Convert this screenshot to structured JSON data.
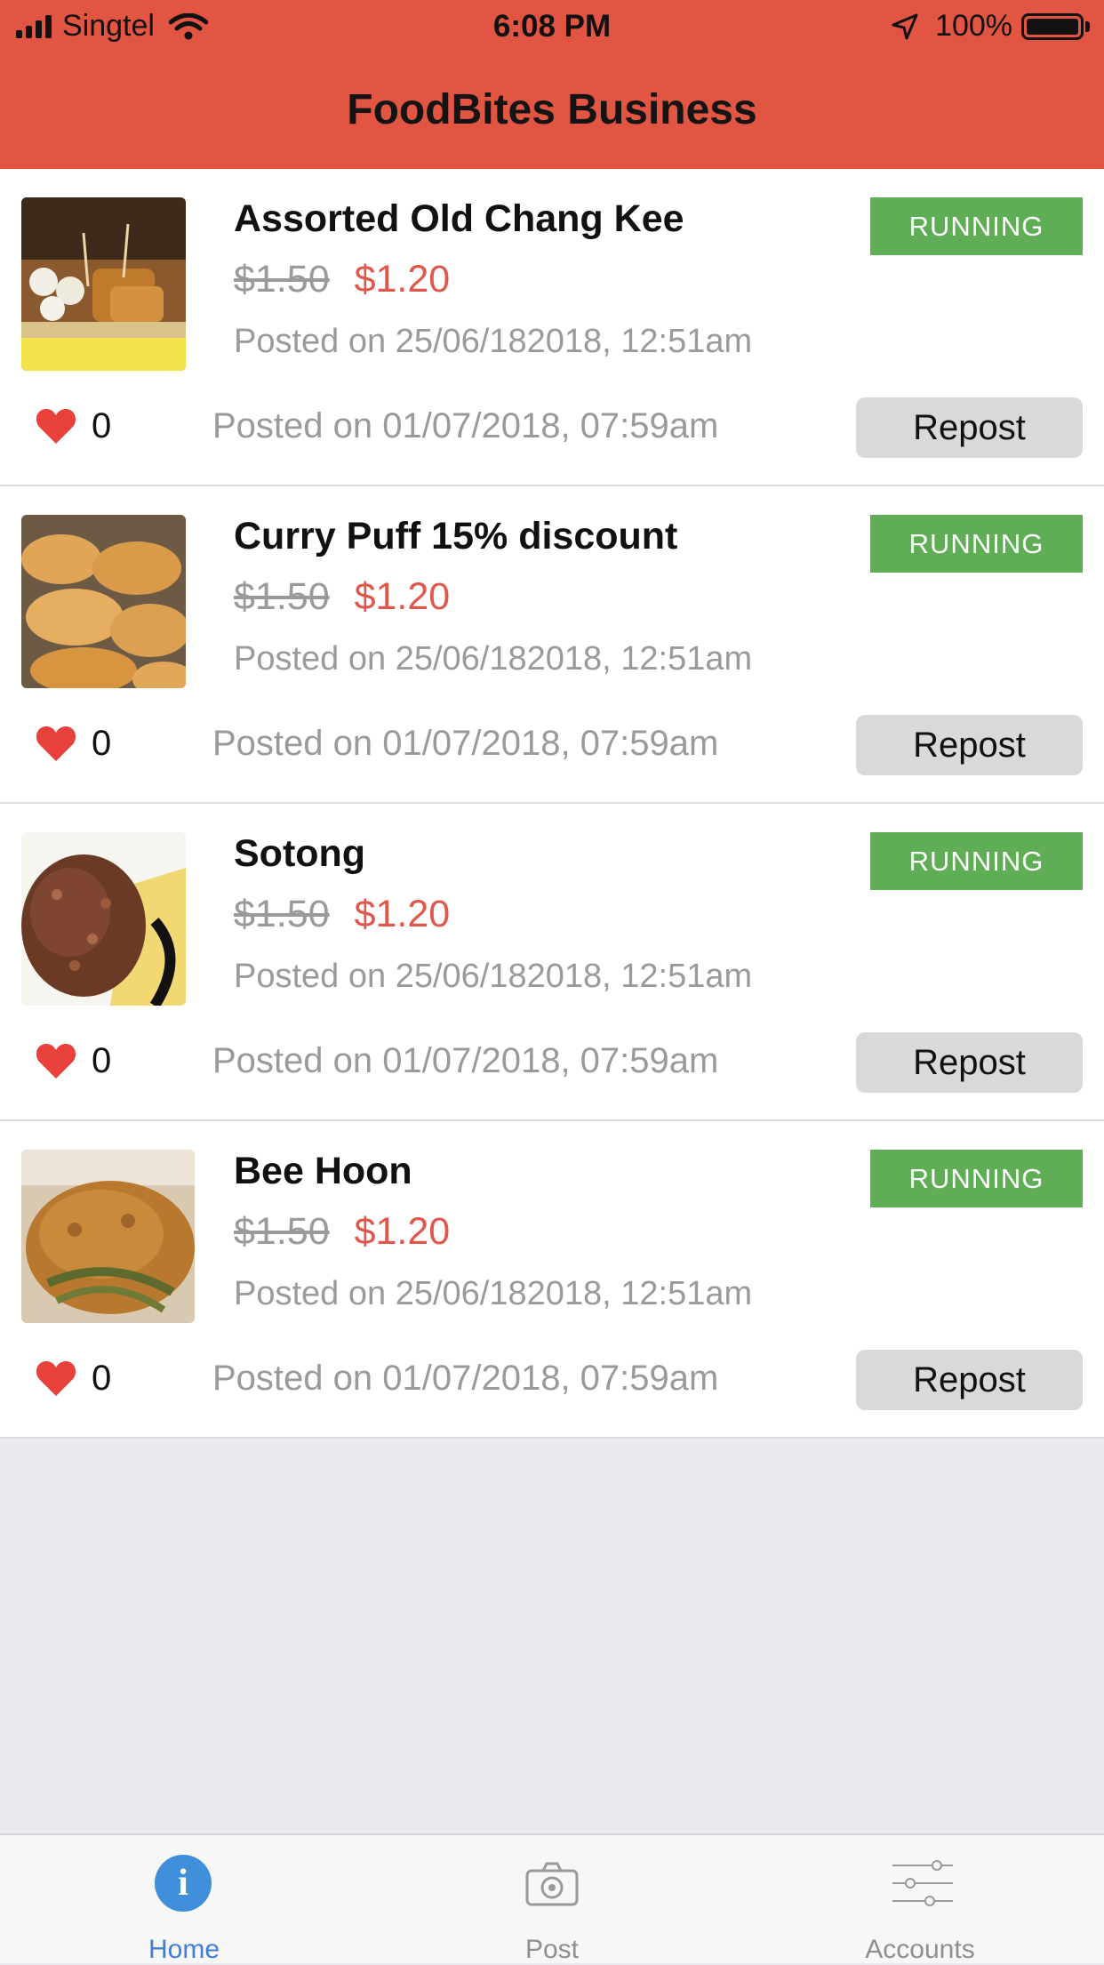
{
  "status_bar": {
    "carrier": "Singtel",
    "time": "6:08 PM",
    "battery": "100%"
  },
  "header": {
    "title": "FoodBites Business"
  },
  "posts": [
    {
      "title": "Assorted Old Chang Kee",
      "old_price": "$1.50",
      "new_price": "$1.20",
      "posted_top": "Posted on 25/06/182018, 12:51am",
      "status": "RUNNING",
      "likes": "0",
      "posted_bottom": "Posted on 01/07/2018, 07:59am",
      "repost_label": "Repost"
    },
    {
      "title": "Curry Puff 15% discount",
      "old_price": "$1.50",
      "new_price": "$1.20",
      "posted_top": "Posted on 25/06/182018, 12:51am",
      "status": "RUNNING",
      "likes": "0",
      "posted_bottom": "Posted on 01/07/2018, 07:59am",
      "repost_label": "Repost"
    },
    {
      "title": "Sotong",
      "old_price": "$1.50",
      "new_price": "$1.20",
      "posted_top": "Posted on 25/06/182018, 12:51am",
      "status": "RUNNING",
      "likes": "0",
      "posted_bottom": "Posted on 01/07/2018, 07:59am",
      "repost_label": "Repost"
    },
    {
      "title": "Bee Hoon",
      "old_price": "$1.50",
      "new_price": "$1.20",
      "posted_top": "Posted on 25/06/182018, 12:51am",
      "status": "RUNNING",
      "likes": "0",
      "posted_bottom": "Posted on 01/07/2018, 07:59am",
      "repost_label": "Repost"
    }
  ],
  "tabs": [
    {
      "label": "Home",
      "icon": "info-icon",
      "active": true
    },
    {
      "label": "Post",
      "icon": "camera-icon",
      "active": false
    },
    {
      "label": "Accounts",
      "icon": "sliders-icon",
      "active": false
    }
  ],
  "colors": {
    "header": "#e35543",
    "running_badge": "#5fae55",
    "sale_price": "#e0574c",
    "active_tab": "#3f7fd6"
  }
}
